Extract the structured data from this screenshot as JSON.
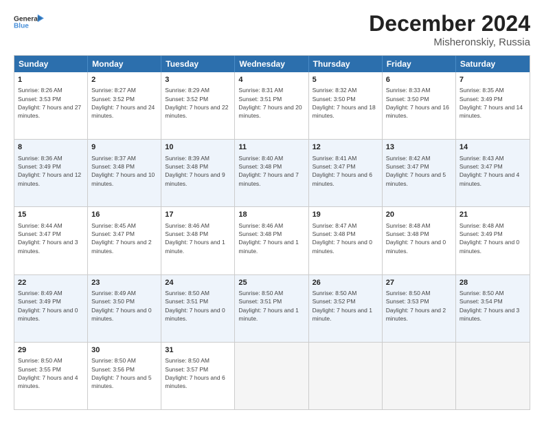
{
  "header": {
    "logo_line1": "General",
    "logo_line2": "Blue",
    "main_title": "December 2024",
    "subtitle": "Misheronskiy, Russia"
  },
  "calendar": {
    "days": [
      "Sunday",
      "Monday",
      "Tuesday",
      "Wednesday",
      "Thursday",
      "Friday",
      "Saturday"
    ],
    "rows": [
      [
        {
          "day": "1",
          "sunrise": "Sunrise: 8:26 AM",
          "sunset": "Sunset: 3:53 PM",
          "daylight": "Daylight: 7 hours and 27 minutes."
        },
        {
          "day": "2",
          "sunrise": "Sunrise: 8:27 AM",
          "sunset": "Sunset: 3:52 PM",
          "daylight": "Daylight: 7 hours and 24 minutes."
        },
        {
          "day": "3",
          "sunrise": "Sunrise: 8:29 AM",
          "sunset": "Sunset: 3:52 PM",
          "daylight": "Daylight: 7 hours and 22 minutes."
        },
        {
          "day": "4",
          "sunrise": "Sunrise: 8:31 AM",
          "sunset": "Sunset: 3:51 PM",
          "daylight": "Daylight: 7 hours and 20 minutes."
        },
        {
          "day": "5",
          "sunrise": "Sunrise: 8:32 AM",
          "sunset": "Sunset: 3:50 PM",
          "daylight": "Daylight: 7 hours and 18 minutes."
        },
        {
          "day": "6",
          "sunrise": "Sunrise: 8:33 AM",
          "sunset": "Sunset: 3:50 PM",
          "daylight": "Daylight: 7 hours and 16 minutes."
        },
        {
          "day": "7",
          "sunrise": "Sunrise: 8:35 AM",
          "sunset": "Sunset: 3:49 PM",
          "daylight": "Daylight: 7 hours and 14 minutes."
        }
      ],
      [
        {
          "day": "8",
          "sunrise": "Sunrise: 8:36 AM",
          "sunset": "Sunset: 3:49 PM",
          "daylight": "Daylight: 7 hours and 12 minutes."
        },
        {
          "day": "9",
          "sunrise": "Sunrise: 8:37 AM",
          "sunset": "Sunset: 3:48 PM",
          "daylight": "Daylight: 7 hours and 10 minutes."
        },
        {
          "day": "10",
          "sunrise": "Sunrise: 8:39 AM",
          "sunset": "Sunset: 3:48 PM",
          "daylight": "Daylight: 7 hours and 9 minutes."
        },
        {
          "day": "11",
          "sunrise": "Sunrise: 8:40 AM",
          "sunset": "Sunset: 3:48 PM",
          "daylight": "Daylight: 7 hours and 7 minutes."
        },
        {
          "day": "12",
          "sunrise": "Sunrise: 8:41 AM",
          "sunset": "Sunset: 3:47 PM",
          "daylight": "Daylight: 7 hours and 6 minutes."
        },
        {
          "day": "13",
          "sunrise": "Sunrise: 8:42 AM",
          "sunset": "Sunset: 3:47 PM",
          "daylight": "Daylight: 7 hours and 5 minutes."
        },
        {
          "day": "14",
          "sunrise": "Sunrise: 8:43 AM",
          "sunset": "Sunset: 3:47 PM",
          "daylight": "Daylight: 7 hours and 4 minutes."
        }
      ],
      [
        {
          "day": "15",
          "sunrise": "Sunrise: 8:44 AM",
          "sunset": "Sunset: 3:47 PM",
          "daylight": "Daylight: 7 hours and 3 minutes."
        },
        {
          "day": "16",
          "sunrise": "Sunrise: 8:45 AM",
          "sunset": "Sunset: 3:47 PM",
          "daylight": "Daylight: 7 hours and 2 minutes."
        },
        {
          "day": "17",
          "sunrise": "Sunrise: 8:46 AM",
          "sunset": "Sunset: 3:48 PM",
          "daylight": "Daylight: 7 hours and 1 minute."
        },
        {
          "day": "18",
          "sunrise": "Sunrise: 8:46 AM",
          "sunset": "Sunset: 3:48 PM",
          "daylight": "Daylight: 7 hours and 1 minute."
        },
        {
          "day": "19",
          "sunrise": "Sunrise: 8:47 AM",
          "sunset": "Sunset: 3:48 PM",
          "daylight": "Daylight: 7 hours and 0 minutes."
        },
        {
          "day": "20",
          "sunrise": "Sunrise: 8:48 AM",
          "sunset": "Sunset: 3:48 PM",
          "daylight": "Daylight: 7 hours and 0 minutes."
        },
        {
          "day": "21",
          "sunrise": "Sunrise: 8:48 AM",
          "sunset": "Sunset: 3:49 PM",
          "daylight": "Daylight: 7 hours and 0 minutes."
        }
      ],
      [
        {
          "day": "22",
          "sunrise": "Sunrise: 8:49 AM",
          "sunset": "Sunset: 3:49 PM",
          "daylight": "Daylight: 7 hours and 0 minutes."
        },
        {
          "day": "23",
          "sunrise": "Sunrise: 8:49 AM",
          "sunset": "Sunset: 3:50 PM",
          "daylight": "Daylight: 7 hours and 0 minutes."
        },
        {
          "day": "24",
          "sunrise": "Sunrise: 8:50 AM",
          "sunset": "Sunset: 3:51 PM",
          "daylight": "Daylight: 7 hours and 0 minutes."
        },
        {
          "day": "25",
          "sunrise": "Sunrise: 8:50 AM",
          "sunset": "Sunset: 3:51 PM",
          "daylight": "Daylight: 7 hours and 1 minute."
        },
        {
          "day": "26",
          "sunrise": "Sunrise: 8:50 AM",
          "sunset": "Sunset: 3:52 PM",
          "daylight": "Daylight: 7 hours and 1 minute."
        },
        {
          "day": "27",
          "sunrise": "Sunrise: 8:50 AM",
          "sunset": "Sunset: 3:53 PM",
          "daylight": "Daylight: 7 hours and 2 minutes."
        },
        {
          "day": "28",
          "sunrise": "Sunrise: 8:50 AM",
          "sunset": "Sunset: 3:54 PM",
          "daylight": "Daylight: 7 hours and 3 minutes."
        }
      ],
      [
        {
          "day": "29",
          "sunrise": "Sunrise: 8:50 AM",
          "sunset": "Sunset: 3:55 PM",
          "daylight": "Daylight: 7 hours and 4 minutes."
        },
        {
          "day": "30",
          "sunrise": "Sunrise: 8:50 AM",
          "sunset": "Sunset: 3:56 PM",
          "daylight": "Daylight: 7 hours and 5 minutes."
        },
        {
          "day": "31",
          "sunrise": "Sunrise: 8:50 AM",
          "sunset": "Sunset: 3:57 PM",
          "daylight": "Daylight: 7 hours and 6 minutes."
        },
        null,
        null,
        null,
        null
      ]
    ]
  }
}
